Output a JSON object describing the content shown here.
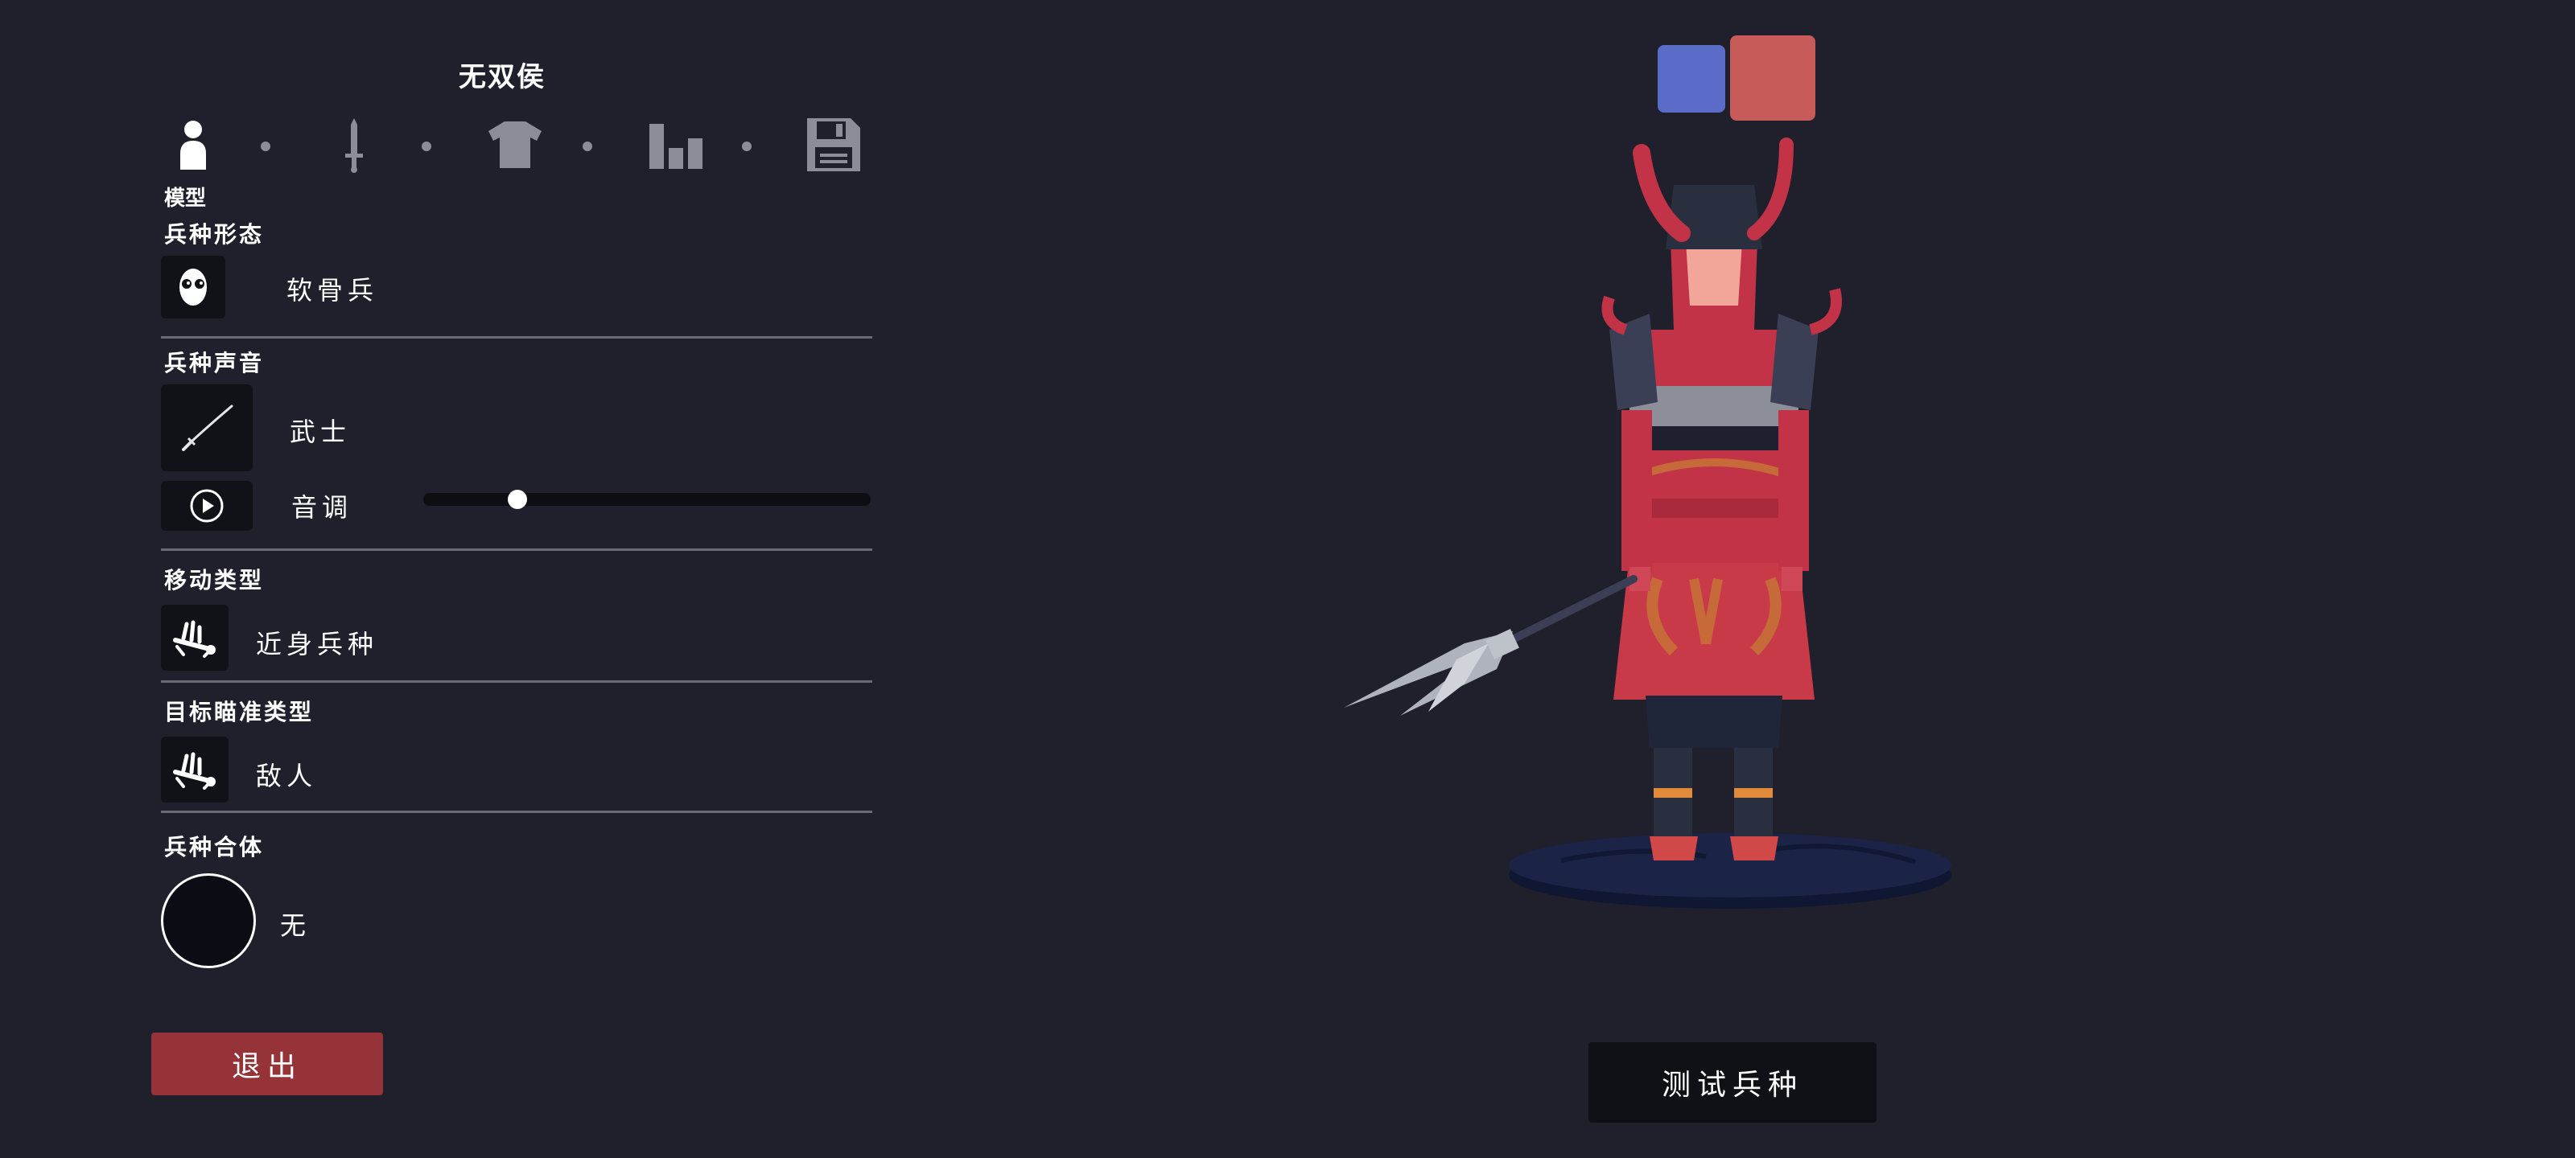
{
  "unit": {
    "name": "无双侯"
  },
  "tabs": [
    {
      "id": "model",
      "icon": "person-icon"
    },
    {
      "id": "weapons",
      "icon": "sword-icon"
    },
    {
      "id": "clothing",
      "icon": "shirt-icon"
    },
    {
      "id": "stats",
      "icon": "bar-chart-icon"
    },
    {
      "id": "save",
      "icon": "floppy-disk-icon"
    }
  ],
  "active_tab_label": "模型",
  "sections": {
    "form": {
      "title": "兵种形态",
      "value": "软骨兵",
      "icon": "mask-face-icon"
    },
    "voice": {
      "title": "兵种声音",
      "value": "武士",
      "icon": "katana-icon",
      "play_icon": "play-icon",
      "pitch_label": "音调",
      "pitch_value": 0.21
    },
    "movement": {
      "title": "移动类型",
      "value": "近身兵种",
      "icon": "melee-unit-icon"
    },
    "targeting": {
      "title": "目标瞄准类型",
      "value": "敌人",
      "icon": "melee-unit-icon"
    },
    "combine": {
      "title": "兵种合体",
      "value": "无"
    }
  },
  "buttons": {
    "exit": "退出",
    "test_unit": "测试兵种"
  },
  "team_colors": {
    "blue": "#5a6cc7",
    "red": "#c75b5a"
  },
  "colors": {
    "background": "#20202c",
    "accent_red": "#953338"
  },
  "preview": {
    "subject": "samurai-character-with-glaive"
  }
}
